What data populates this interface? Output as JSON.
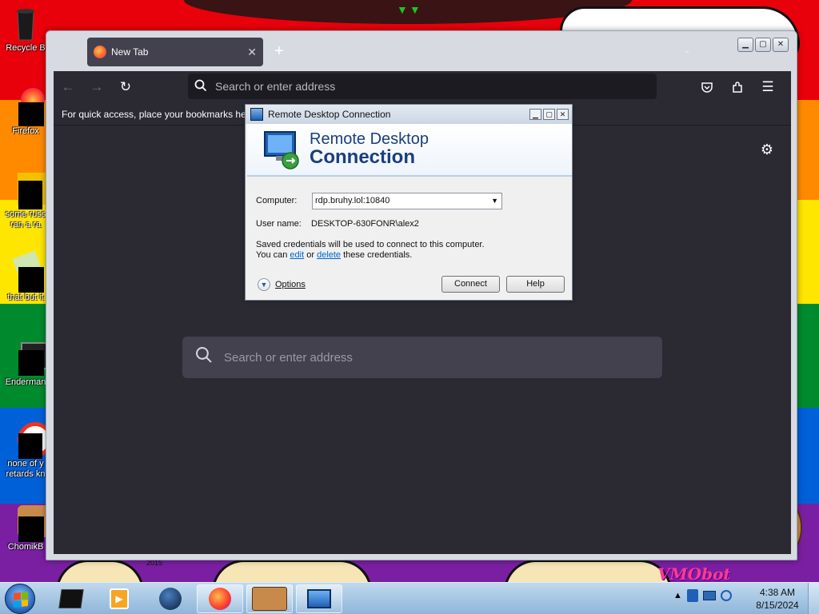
{
  "desktop": {
    "wallpaper_colors": [
      "#e8000b",
      "#ff8a00",
      "#ffe600",
      "#008a2e",
      "#0060d8",
      "#7a1fa2"
    ],
    "wallpaper_text": "VMObot",
    "wallpaper_small_text": "2015",
    "icons": [
      {
        "label": "Recycle B",
        "icon": "recycle-bin-icon"
      },
      {
        "label": "Firefox",
        "icon": "firefox-icon"
      },
      {
        "label": "some russ\nran a ra",
        "icon": "folder-icon"
      },
      {
        "label": "that but it",
        "icon": "shortcut-icon"
      },
      {
        "label": "Enderman",
        "icon": "app-icon"
      },
      {
        "label": "none of y\nretards kn",
        "icon": "app-icon"
      },
      {
        "label": "ChomikB",
        "icon": "hamster-icon"
      }
    ]
  },
  "firefox": {
    "tab_title": "New Tab",
    "tab_close": "✕",
    "new_tab": "+",
    "urlbar_placeholder": "Search or enter address",
    "bookmarks_hint": "For quick access, place your bookmarks here",
    "content_search_placeholder": "Search or enter address"
  },
  "rdp": {
    "window_title": "Remote Desktop Connection",
    "banner_line1": "Remote Desktop",
    "banner_line2": "Connection",
    "computer_label": "Computer:",
    "computer_value": "rdp.bruhy.lol:10840",
    "username_label": "User name:",
    "username_value": "DESKTOP-630FONR\\alex2",
    "info_line1": "Saved credentials will be used to connect to this computer.",
    "info_you_can": "You can",
    "info_edit": "edit",
    "info_or": "or",
    "info_delete": "delete",
    "info_tail": "these credentials.",
    "options_label": "Options",
    "connect_label": "Connect",
    "help_label": "Help"
  },
  "taskbar": {
    "items": [
      "terminal-icon",
      "media-player-icon",
      "globe-icon",
      "firefox-icon",
      "chomikbox-icon",
      "remote-desktop-icon"
    ],
    "clock_time": "4:38 AM",
    "clock_date": "8/15/2024",
    "tray_expand": "▲"
  }
}
